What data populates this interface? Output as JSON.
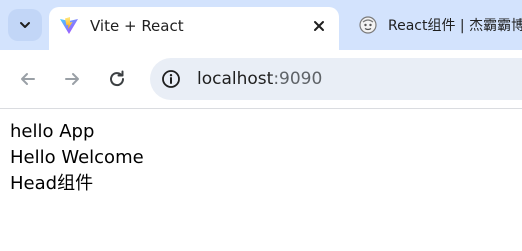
{
  "browser": {
    "tabs": [
      {
        "title": "Vite + React",
        "active": true,
        "favicon": "vite-logo-icon"
      },
      {
        "title": "React组件 | 杰霸霸博",
        "active": false,
        "favicon": "sticker-favicon-icon"
      }
    ],
    "address": {
      "host": "localhost",
      "port": ":9090"
    },
    "colors": {
      "tab_strip_bg": "#d3e3fd",
      "omnibox_bg": "#e9eef6"
    }
  },
  "page": {
    "lines": [
      "hello App",
      "Hello Welcome",
      "Head组件"
    ]
  }
}
